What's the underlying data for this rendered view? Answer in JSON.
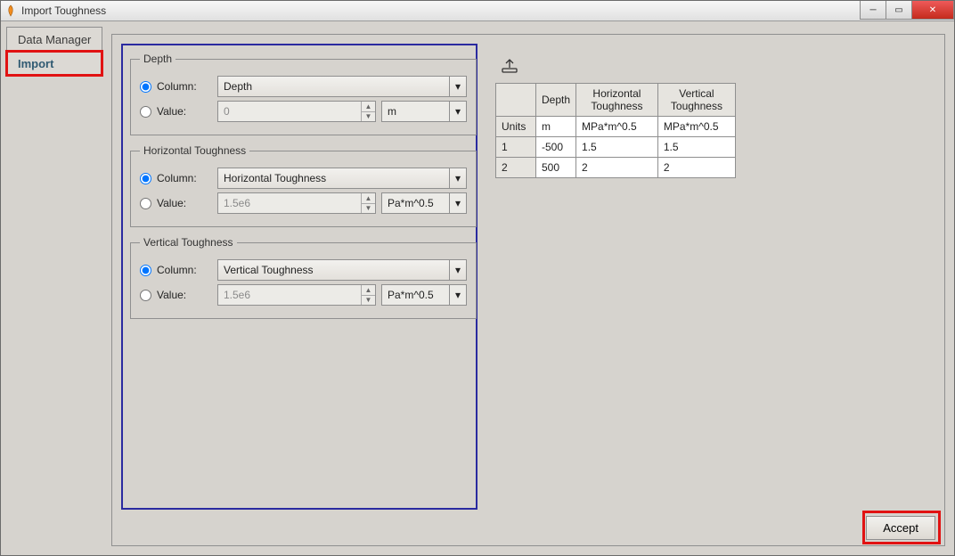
{
  "window": {
    "title": "Import Toughness"
  },
  "tabs": {
    "data_manager": "Data Manager",
    "import": "Import"
  },
  "groups": {
    "depth": {
      "legend": "Depth",
      "column_label": "Column:",
      "value_label": "Value:",
      "column_selected": "Depth",
      "value_number": "0",
      "value_unit": "m"
    },
    "horiz": {
      "legend": "Horizontal Toughness",
      "column_label": "Column:",
      "value_label": "Value:",
      "column_selected": "Horizontal Toughness",
      "value_number": "1.5e6",
      "value_unit": "Pa*m^0.5"
    },
    "vert": {
      "legend": "Vertical Toughness",
      "column_label": "Column:",
      "value_label": "Value:",
      "column_selected": "Vertical Toughness",
      "value_number": "1.5e6",
      "value_unit": "Pa*m^0.5"
    }
  },
  "table": {
    "headers": {
      "depth": "Depth",
      "h": "Horizontal Toughness",
      "v": "Vertical Toughness"
    },
    "units_label": "Units",
    "units": {
      "depth": "m",
      "h": "MPa*m^0.5",
      "v": "MPa*m^0.5"
    },
    "rows": [
      {
        "idx": "1",
        "depth": "-500",
        "h": "1.5",
        "v": "1.5"
      },
      {
        "idx": "2",
        "depth": "500",
        "h": "2",
        "v": "2"
      }
    ]
  },
  "accept_label": "Accept"
}
